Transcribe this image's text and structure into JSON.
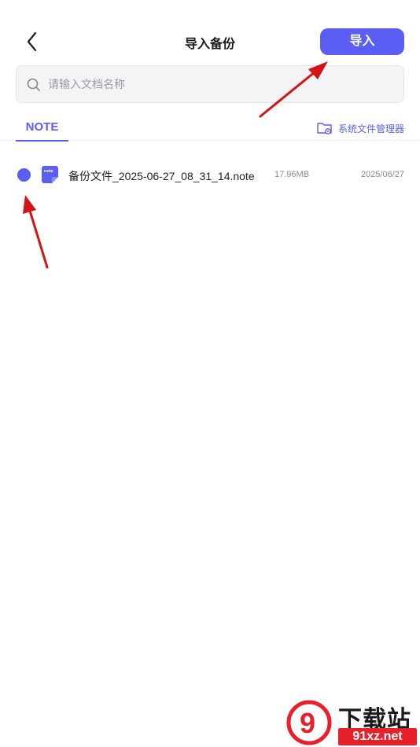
{
  "header": {
    "title": "导入备份",
    "import_label": "导入"
  },
  "search": {
    "placeholder": "请输入文档名称",
    "value": ""
  },
  "tabs": [
    {
      "label": "NOTE",
      "active": true
    }
  ],
  "file_manager_link": "系统文件管理器",
  "files": [
    {
      "icon_label": "note",
      "name": "备份文件_2025-06-27_08_31_14.note",
      "size": "17.96MB",
      "date": "2025/06/27",
      "selected": true
    }
  ],
  "watermark": {
    "logo_text": "9",
    "top_text": "下载站",
    "bottom_text": "91xz.net"
  },
  "colors": {
    "accent": "#5b5ef2",
    "annotation_arrow": "#d41414",
    "watermark_red": "#e8202a"
  }
}
